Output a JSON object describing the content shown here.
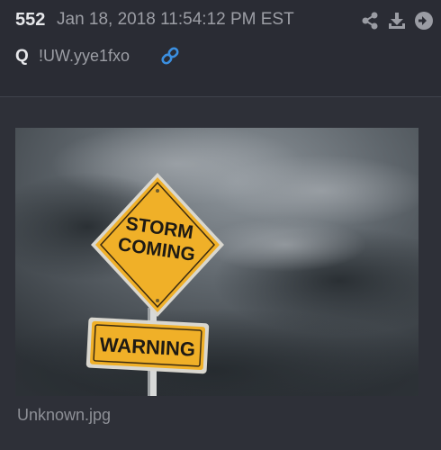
{
  "post": {
    "number": "552",
    "date": "Jan 18, 2018 11:54:12 PM EST",
    "author": "Q",
    "tripcode": "!UW.yye1fxo"
  },
  "attachment": {
    "sign_line1": "STORM",
    "sign_line2": "COMING",
    "warning_text": "WARNING",
    "file_name": "Unknown.jpg"
  },
  "icons": {
    "share": "share-icon",
    "download": "download-icon",
    "goto": "arrow-circle-right-icon",
    "link": "link-icon"
  },
  "colors": {
    "background": "#2e3038",
    "header_background": "#2a2c34",
    "link_blue": "#3b8fe0",
    "sign_yellow": "#f0b028"
  }
}
